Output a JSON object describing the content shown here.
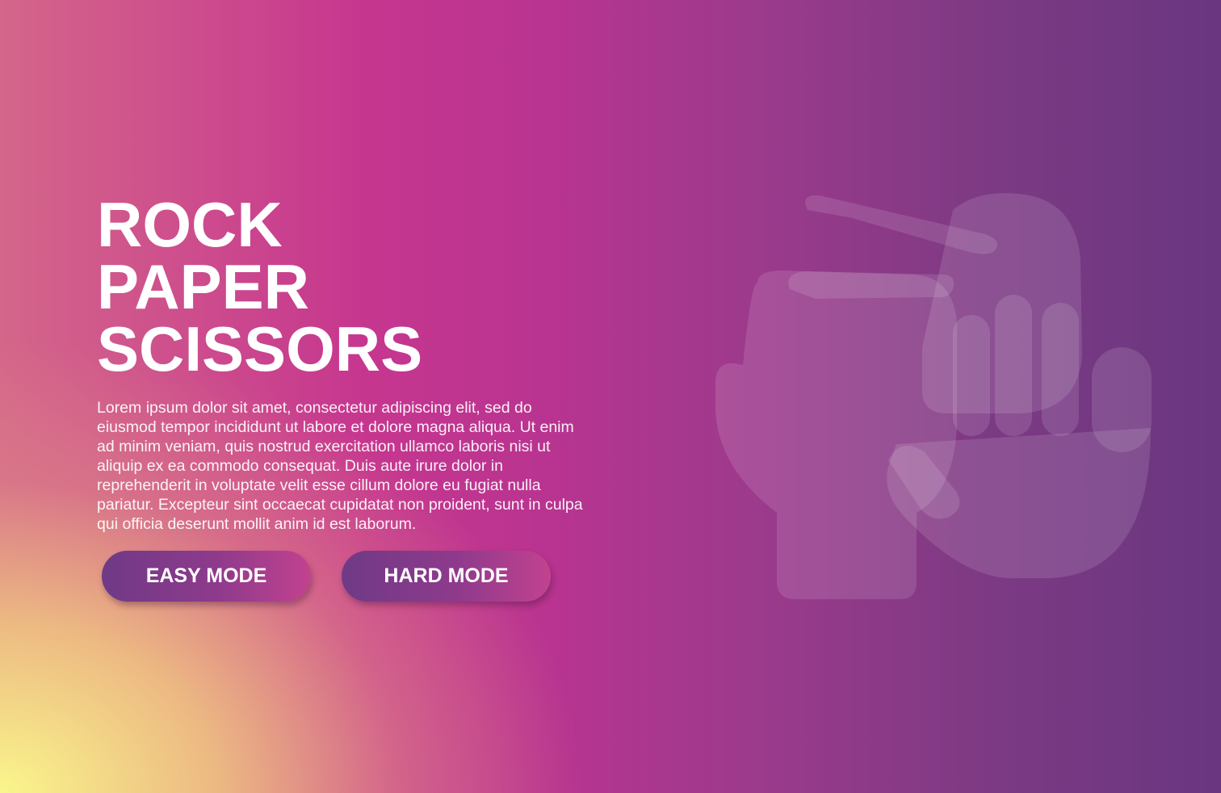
{
  "hero": {
    "title_lines": [
      "ROCK",
      "PAPER",
      "SCISSORS"
    ],
    "description": "Lorem ipsum dolor sit amet, consectetur adipiscing elit, sed do eiusmod tempor incididunt ut labore et dolore magna aliqua. Ut enim ad minim veniam, quis nostrud exercitation ullamco laboris nisi ut aliquip ex ea commodo consequat. Duis aute irure dolor in reprehenderit in voluptate velit esse cillum dolore eu fugiat nulla pariatur. Excepteur sint occaecat cupidatat non proident, sunt in culpa qui officia deserunt mollit anim id est laborum."
  },
  "buttons": {
    "easy_label": "EASY MODE",
    "hard_label": "HARD MODE"
  },
  "illustration": {
    "icon": "rock-paper-scissors-hands-icon"
  },
  "colors": {
    "gradient_yellow": "#faf68c",
    "gradient_pink": "#c6368f",
    "gradient_purple": "#6a3680",
    "button_start": "#6f3a86",
    "button_end": "#c2428f",
    "text": "#ffffff"
  }
}
